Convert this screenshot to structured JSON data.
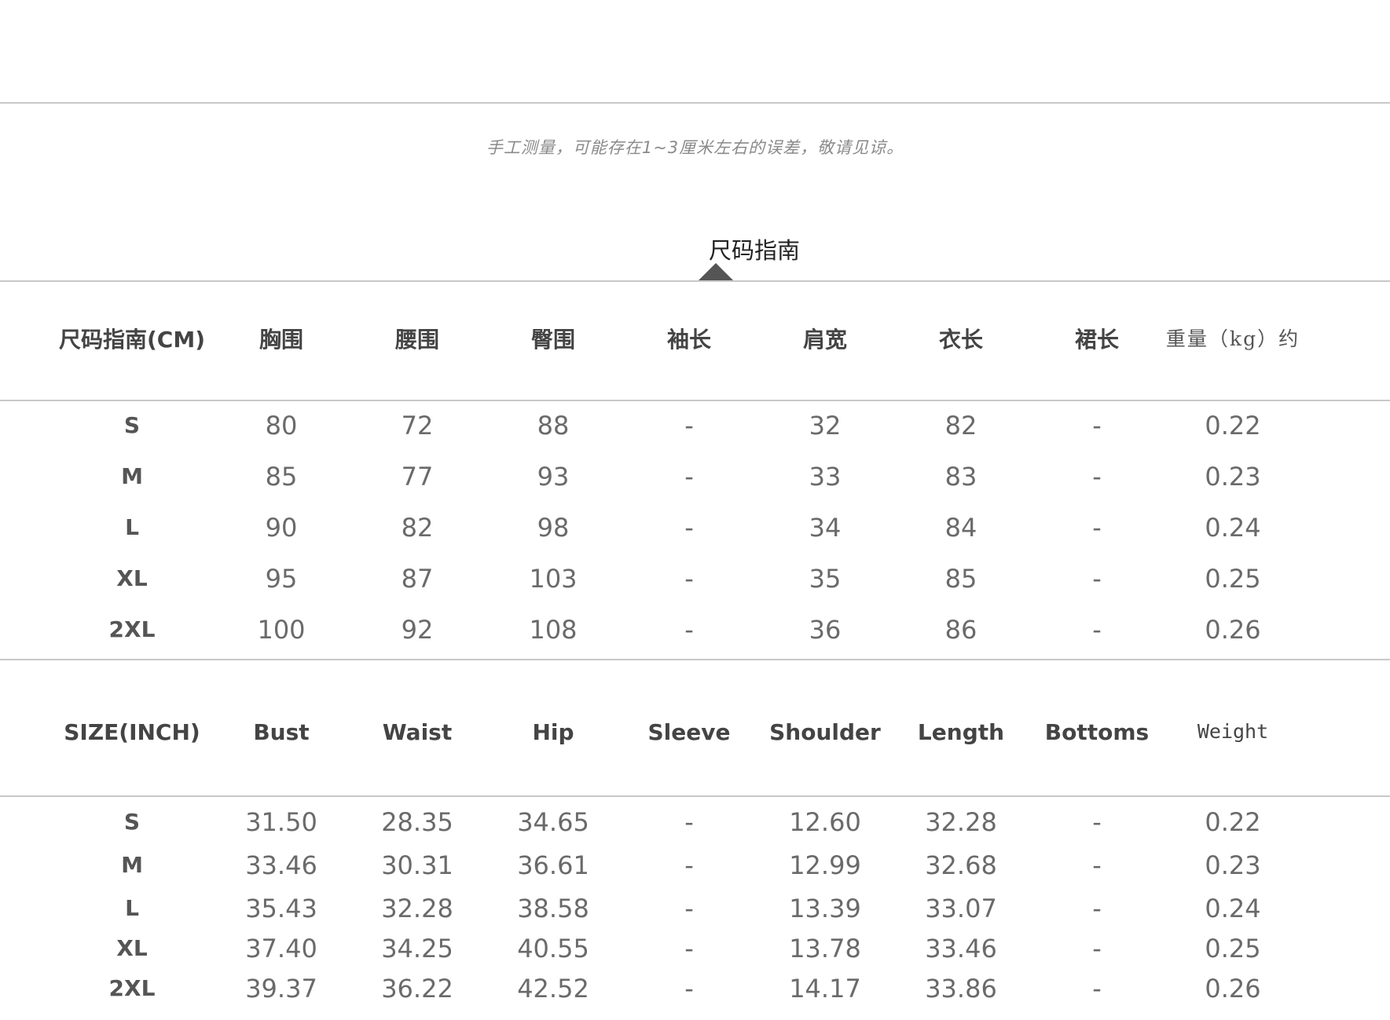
{
  "note": "手工测量，可能存在1~3厘米左右的误差，敬请见谅。",
  "section_title": "尺码指南",
  "cm_table": {
    "headers": [
      "尺码指南(CM)",
      "胸围",
      "腰围",
      "臀围",
      "袖长",
      "肩宽",
      "衣长",
      "裙长",
      "重量（kg）约"
    ],
    "rows": [
      [
        "S",
        "80",
        "72",
        "88",
        "-",
        "32",
        "82",
        "-",
        "0.22"
      ],
      [
        "M",
        "85",
        "77",
        "93",
        "-",
        "33",
        "83",
        "-",
        "0.23"
      ],
      [
        "L",
        "90",
        "82",
        "98",
        "-",
        "34",
        "84",
        "-",
        "0.24"
      ],
      [
        "XL",
        "95",
        "87",
        "103",
        "-",
        "35",
        "85",
        "-",
        "0.25"
      ],
      [
        "2XL",
        "100",
        "92",
        "108",
        "-",
        "36",
        "86",
        "-",
        "0.26"
      ]
    ]
  },
  "inch_table": {
    "headers": [
      "SIZE(INCH)",
      "Bust",
      "Waist",
      "Hip",
      "Sleeve",
      "Shoulder",
      "Length",
      "Bottoms",
      "Weight"
    ],
    "rows": [
      [
        "S",
        "31.50",
        "28.35",
        "34.65",
        "-",
        "12.60",
        "32.28",
        "-",
        "0.22"
      ],
      [
        "M",
        "33.46",
        "30.31",
        "36.61",
        "-",
        "12.99",
        "32.68",
        "-",
        "0.23"
      ],
      [
        "L",
        "35.43",
        "32.28",
        "38.58",
        "-",
        "13.39",
        "33.07",
        "-",
        "0.24"
      ],
      [
        "XL",
        "37.40",
        "34.25",
        "40.55",
        "-",
        "13.78",
        "33.46",
        "-",
        "0.25"
      ],
      [
        "2XL",
        "39.37",
        "36.22",
        "42.52",
        "-",
        "14.17",
        "33.86",
        "-",
        "0.26"
      ]
    ]
  }
}
